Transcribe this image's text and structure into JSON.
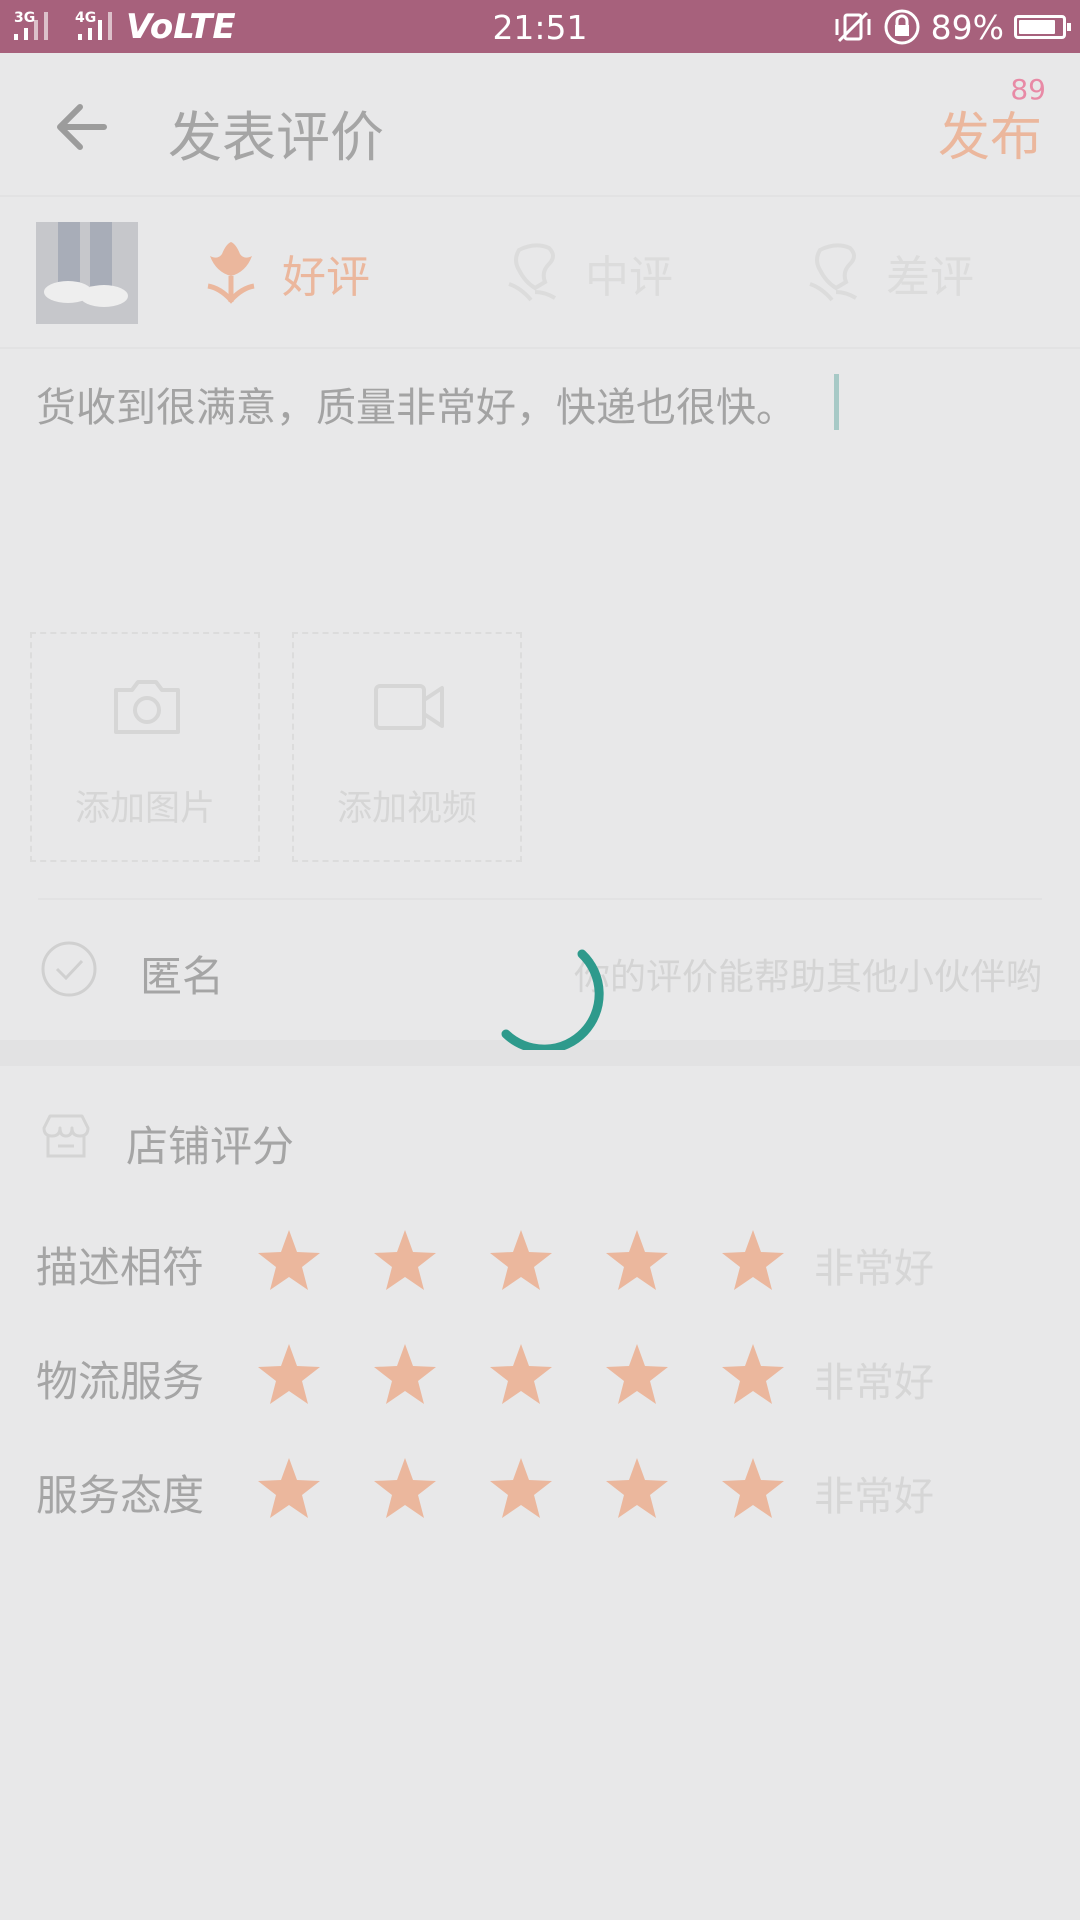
{
  "status_bar": {
    "net1": "3G",
    "net2": "4G",
    "volte": "VoLTE",
    "time": "21:51",
    "battery_pct_label": "89%",
    "battery_level": 0.89,
    "icons": [
      "signal-icon",
      "signal-icon",
      "vibrate-off-icon",
      "rotation-lock-icon",
      "battery-icon"
    ]
  },
  "header": {
    "title": "发表评价",
    "char_count": "89",
    "publish_label": "发布"
  },
  "rating_options": [
    {
      "label": "好评",
      "selected": true,
      "color": "#ebb79d"
    },
    {
      "label": "中评",
      "selected": false,
      "color": "#dcdcdc"
    },
    {
      "label": "差评",
      "selected": false,
      "color": "#dcdcdc"
    }
  ],
  "comment": {
    "text": "货收到很满意，质量非常好，快递也很快。"
  },
  "media": {
    "add_photo_label": "添加图片",
    "add_video_label": "添加视频"
  },
  "anonymous": {
    "label": "匿名",
    "checked": false,
    "hint": "你的评价能帮助其他小伙伴哟"
  },
  "store_rating": {
    "title": "店铺评分",
    "rows": [
      {
        "label": "描述相符",
        "stars": 5,
        "value_label": "非常好"
      },
      {
        "label": "物流服务",
        "stars": 5,
        "value_label": "非常好"
      },
      {
        "label": "服务态度",
        "stars": 5,
        "value_label": "非常好"
      }
    ]
  },
  "colors": {
    "status_bar": "#a7617c",
    "accent": "#ebb79d",
    "spinner": "#2e9a8c",
    "background": "#e8e8e9"
  },
  "loading": true
}
